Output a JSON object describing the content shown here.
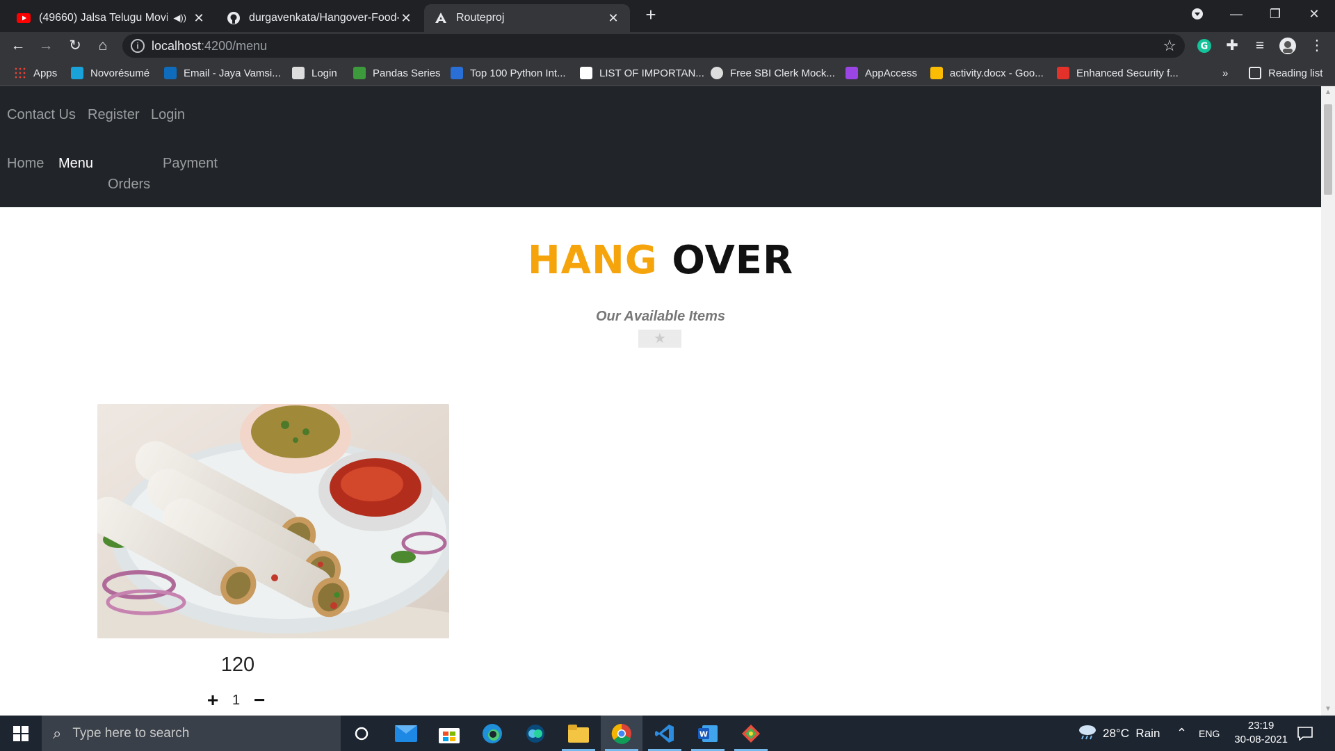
{
  "browser": {
    "tabs": [
      {
        "title": "(49660) Jalsa Telugu Movie F",
        "favicon": "youtube-icon"
      },
      {
        "title": "durgavenkata/Hangover-Food-Sp",
        "favicon": "github-icon"
      },
      {
        "title": "Routeproj",
        "favicon": "angular-icon",
        "active": true
      }
    ],
    "url_host": "localhost",
    "url_path": ":4200/menu",
    "bookmarks": [
      {
        "label": "Apps",
        "color": "#e94235"
      },
      {
        "label": "Novorésumé",
        "color": "#1aa3d9"
      },
      {
        "label": "Email - Jaya Vamsi...",
        "color": "#0f6cbd"
      },
      {
        "label": "Login",
        "color": "#dddddd"
      },
      {
        "label": "Pandas Series",
        "color": "#3c9a3c"
      },
      {
        "label": "Top 100 Python Int...",
        "color": "#2a6fd6"
      },
      {
        "label": "LIST OF IMPORTAN...",
        "color": "#ffffff"
      },
      {
        "label": "Free SBI Clerk Mock...",
        "color": "#dddddd"
      },
      {
        "label": "AppAccess",
        "color": "#9b45e4"
      },
      {
        "label": "activity.docx - Goo...",
        "color": "#fbbc04"
      },
      {
        "label": "Enhanced Security f...",
        "color": "#e4322b"
      }
    ],
    "reading_list": "Reading list",
    "overflow": "»"
  },
  "nav": {
    "top_links": [
      "Contact Us",
      "Register",
      "Login"
    ],
    "home": "Home",
    "menu": "Menu",
    "payment": "Payment",
    "orders": "Orders"
  },
  "hero": {
    "brand_part1": "HANG",
    "brand_part2": "OVER",
    "subtitle": "Our Available Items",
    "divider_icon": "star-icon"
  },
  "item": {
    "price": "120",
    "quantity": "1",
    "plus": "+",
    "minus": "−"
  },
  "taskbar": {
    "search_placeholder": "Type here to search",
    "weather": "28°C  Rain",
    "language": "ENG",
    "time": "23:19",
    "date": "30-08-2021"
  }
}
